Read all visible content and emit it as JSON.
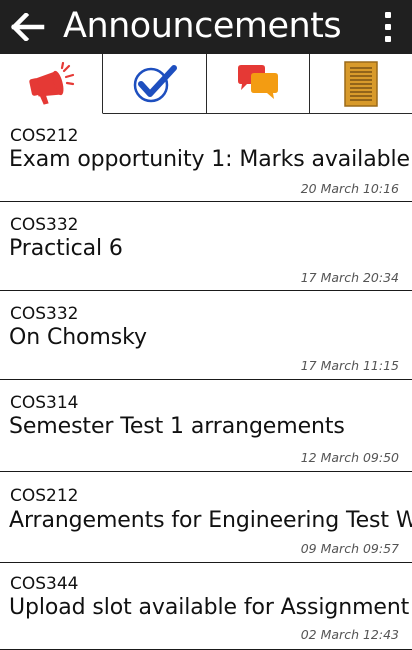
{
  "appbar": {
    "title": "Announcements",
    "back_icon": "arrow-left-icon",
    "menu_icon": "more-vertical-icon"
  },
  "tabs": [
    {
      "name": "announcements",
      "icon": "megaphone-icon",
      "active": true
    },
    {
      "name": "tasks",
      "icon": "checkmark-icon",
      "active": false
    },
    {
      "name": "discussions",
      "icon": "chat-bubbles-icon",
      "active": false
    },
    {
      "name": "notes",
      "icon": "notepad-icon",
      "active": false
    }
  ],
  "announcements": [
    {
      "course": "COS212",
      "title": "Exam opportunity 1: Marks available",
      "time": "20 March 10:16"
    },
    {
      "course": "COS332",
      "title": "Practical 6",
      "time": "17 March 20:34"
    },
    {
      "course": "COS332",
      "title": "On Chomsky",
      "time": "17 March 11:15"
    },
    {
      "course": "COS314",
      "title": "Semester Test 1 arrangements",
      "time": "12 March 09:50"
    },
    {
      "course": "COS212",
      "title": "Arrangements for Engineering Test W",
      "time": "09 March 09:57"
    },
    {
      "course": "COS344",
      "title": "Upload slot available for Assignment",
      "time": "02 March 12:43"
    }
  ],
  "colors": {
    "appbar_bg": "#202020",
    "megaphone": "#e53935",
    "check": "#1e4fbf",
    "chat_red": "#e53935",
    "chat_orange": "#f39c12",
    "notepad": "#d89a2b"
  }
}
